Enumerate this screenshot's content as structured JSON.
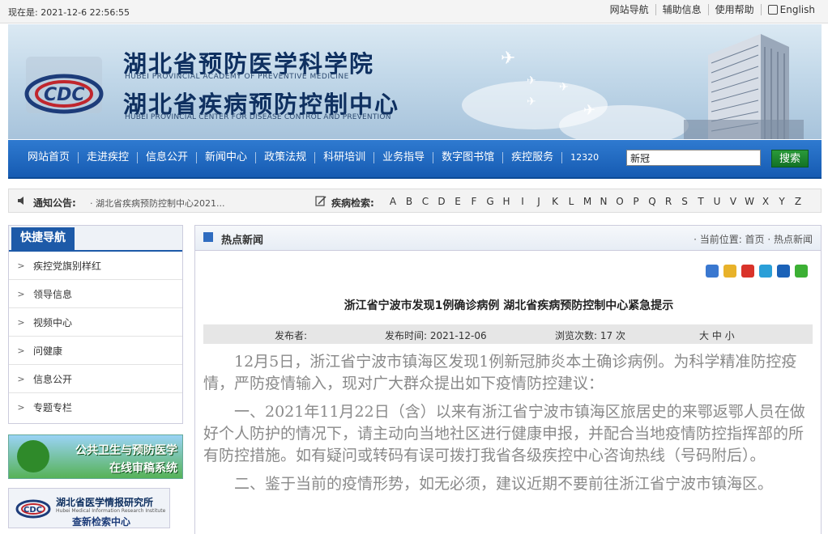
{
  "topbar": {
    "time_label": "现在是: 2021-12-6 22:56:55",
    "links": [
      "网站导航",
      "辅助信息",
      "使用帮助",
      "English"
    ]
  },
  "banner": {
    "title1": "湖北省预防医学科学院",
    "sub1": "HUBEI PROVINCIAL ACADEMY OF PREVENTIVE MEDICINE",
    "title2": "湖北省疾病预防控制中心",
    "sub2": "HUBEI PROVINCIAL CENTER FOR DISEASE CONTROL AND PREVENTION"
  },
  "nav": {
    "items": [
      "网站首页",
      "走进疾控",
      "信息公开",
      "新闻中心",
      "政策法规",
      "科研培训",
      "业务指导",
      "数字图书馆",
      "疾控服务",
      "12320"
    ],
    "search_value": "新冠",
    "search_button": "搜索"
  },
  "notice": {
    "label": "通知公告:",
    "text": "· 湖北省疾病预防控制中心2021...",
    "disease_label": "疾病检索:",
    "letters": [
      "A",
      "B",
      "C",
      "D",
      "E",
      "F",
      "G",
      "H",
      "I",
      "J",
      "K",
      "L",
      "M",
      "N",
      "O",
      "P",
      "Q",
      "R",
      "S",
      "T",
      "U",
      "V",
      "W",
      "X",
      "Y",
      "Z"
    ]
  },
  "sidebar": {
    "title": "快捷导航",
    "items": [
      "疾控党旗别样红",
      "领导信息",
      "视频中心",
      "问健康",
      "信息公开",
      "专题专栏"
    ]
  },
  "ads": {
    "ad1_line1": "公共卫生与预防医学",
    "ad1_line2": "在线审稿系统",
    "ad2_line1": "湖北省医学情报研究所",
    "ad2_line1_en": "Hubei Medical Information Research Institute",
    "ad2_line2": "查新检索中心"
  },
  "content": {
    "section_title": "热点新闻",
    "breadcrumb": "· 当前位置: 首页 · 热点新闻",
    "article_title": "浙江省宁波市发现1例确诊病例 湖北省疾病预防控制中心紧急提示",
    "meta": {
      "publisher": "发布者:",
      "date": "发布时间: 2021-12-06",
      "views": "浏览次数: 17 次",
      "font_size": "大 中 小"
    },
    "paragraphs": [
      "12月5日，浙江省宁波市镇海区发现1例新冠肺炎本土确诊病例。为科学精准防控疫情，严防疫情输入，现对广大群众提出如下疫情防控建议：",
      "一、2021年11月22日（含）以来有浙江省宁波市镇海区旅居史的来鄂返鄂人员在做好个人防护的情况下，请主动向当地社区进行健康申报，并配合当地疫情防控指挥部的所有防控措施。如有疑问或转码有误可拨打我省各级疾控中心咨询热线（号码附后）。",
      "二、鉴于当前的疫情形势，如无必须，建议近期不要前往浙江省宁波市镇海区。"
    ]
  },
  "colors": {
    "nav_blue": "#1d5aa8",
    "search_green": "#1a8a30",
    "title_navy": "#0f3060"
  }
}
